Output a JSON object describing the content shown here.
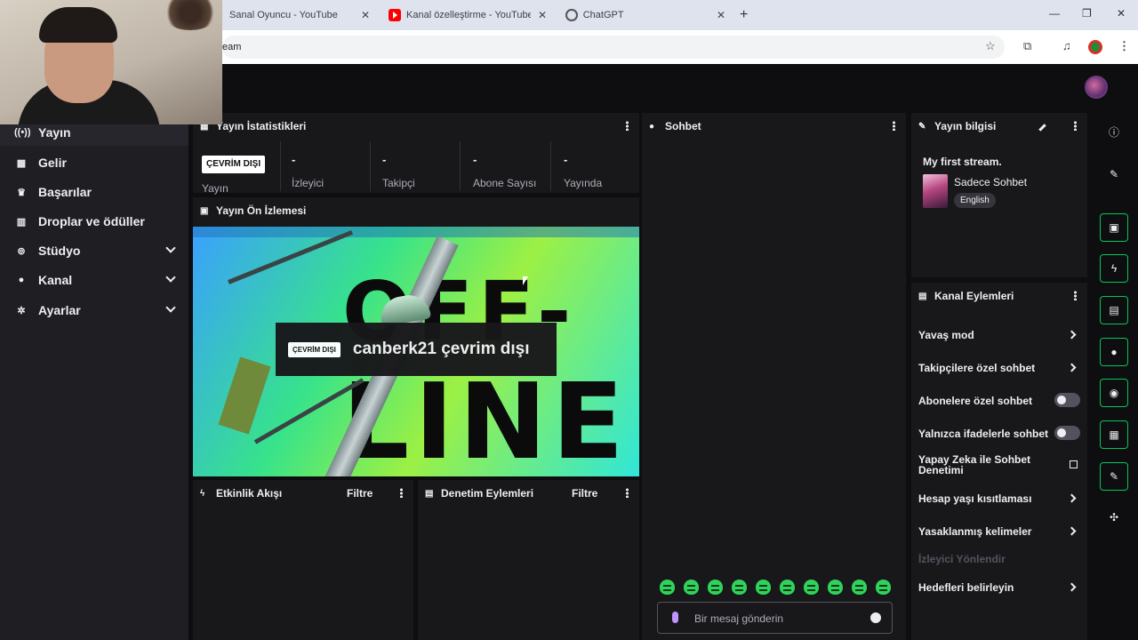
{
  "browser": {
    "tabs": [
      {
        "title": "Sanal Oyuncu - YouTube"
      },
      {
        "title": "Kanal özelleştirme - YouTube St"
      },
      {
        "title": "ChatGPT"
      }
    ],
    "address": "eam"
  },
  "nav": {
    "items": [
      {
        "label": "Yayın",
        "icon": "broadcast-icon",
        "active": true
      },
      {
        "label": "Gelir",
        "icon": "revenue-icon"
      },
      {
        "label": "Başarılar",
        "icon": "trophy-icon"
      },
      {
        "label": "Droplar ve ödüller",
        "icon": "gift-icon"
      },
      {
        "label": "Stüdyo",
        "icon": "studio-icon",
        "expandable": true
      },
      {
        "label": "Kanal",
        "icon": "person-icon",
        "expandable": true
      },
      {
        "label": "Ayarlar",
        "icon": "gear-icon",
        "expandable": true
      }
    ]
  },
  "stats": {
    "title": "Yayın İstatistikleri",
    "status_badge": "ÇEVRİM DIŞI",
    "status_label": "Yayın",
    "items": [
      {
        "value": "-",
        "label": "İzleyici"
      },
      {
        "value": "-",
        "label": "Takipçi"
      },
      {
        "value": "-",
        "label": "Abone Sayısı"
      },
      {
        "value": "-",
        "label": "Yayında"
      }
    ]
  },
  "preview": {
    "title": "Yayın Ön İzlemesi",
    "badge": "ÇEVRİM DIŞI",
    "caption": "canberk21 çevrim dışı"
  },
  "activity": {
    "title": "Etkinlik Akışı",
    "filter": "Filtre"
  },
  "moderation": {
    "title": "Denetim Eylemleri",
    "filter": "Filtre"
  },
  "chat": {
    "title": "Sohbet",
    "placeholder": "Bir mesaj gönderin",
    "emote_color": "#2fd35a"
  },
  "stream_info": {
    "title": "Yayın bilgisi",
    "stream_title": "My first stream.",
    "category": "Sadece Sohbet",
    "tag": "English"
  },
  "channel_actions": {
    "title": "Kanal Eylemleri",
    "items": [
      {
        "label": "Yavaş mod",
        "control": "chevron"
      },
      {
        "label": "Takipçilere özel sohbet",
        "control": "chevron"
      },
      {
        "label": "Abonelere özel sohbet",
        "control": "toggle",
        "on": false
      },
      {
        "label": "Yalnızca ifadelerle sohbet",
        "control": "toggle",
        "on": false
      },
      {
        "label": "Yapay Zeka ile Sohbet Denetimi",
        "control": "external"
      },
      {
        "label": "Hesap yaşı kısıtlaması",
        "control": "chevron"
      },
      {
        "label": "Yasaklanmış kelimeler",
        "control": "chevron"
      },
      {
        "label": "İzleyici Yönlendir",
        "control": "none",
        "disabled": true
      },
      {
        "label": "Hedefleri belirleyin",
        "control": "chevron"
      }
    ]
  },
  "colors": {
    "accent": "#00c85a",
    "panel": "#18181b",
    "background": "#0e0e10"
  }
}
